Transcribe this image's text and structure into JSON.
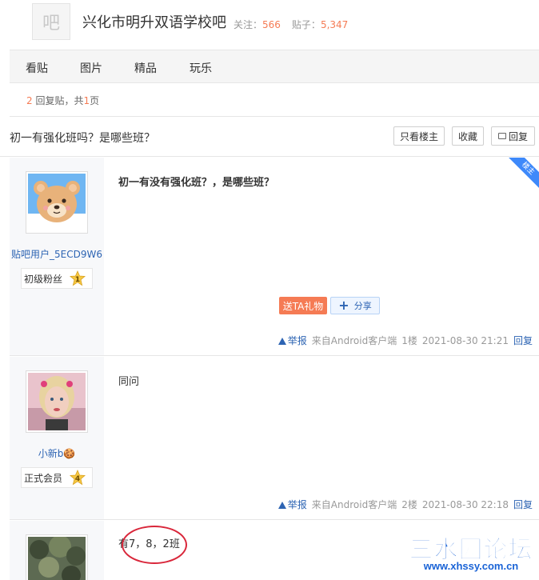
{
  "forum": {
    "logo_char": "吧",
    "name": "兴化市明升双语学校吧",
    "follow_label": "关注：",
    "follow_count": "566",
    "posts_label": "贴子：",
    "posts_count": "5,347"
  },
  "nav": {
    "items": [
      "看贴",
      "图片",
      "精品",
      "玩乐"
    ]
  },
  "pager": {
    "reply_count": "2",
    "reply_text": "回复贴，共",
    "page_count": "1",
    "page_suffix": "页"
  },
  "thread": {
    "title": "初一有强化班吗？是哪些班？",
    "only_op_label": "只看楼主",
    "favorite_label": "收藏",
    "reply_label": "回复"
  },
  "posts": [
    {
      "op_badge": "楼主",
      "user": "贴吧用户_5ECD9W6",
      "level_title": "初级粉丝",
      "level": "1",
      "content": "初一有没有强化班？，是哪些班？",
      "gift_label": "送TA礼物",
      "share_label": "分享",
      "report_label": "举报",
      "source": "来自Android客户端",
      "floor": "1楼",
      "time": "2021-08-30 21:21",
      "reply_label": "回复"
    },
    {
      "user": "小新b🍪",
      "level_title": "正式会员",
      "level": "4",
      "content": "同问",
      "report_label": "举报",
      "source": "来自Android客户端",
      "floor": "2楼",
      "time": "2021-08-30 22:18",
      "reply_label": "回复"
    },
    {
      "content": "有7，8，2班"
    }
  ],
  "watermark": {
    "title": "三水园论坛",
    "url": "www.xhssy.com.cn"
  },
  "colors": {
    "accent_orange": "#f57b54",
    "link_blue": "#2d64b3",
    "op_ribbon": "#3e89fa",
    "annotation_red": "#d9263a"
  }
}
